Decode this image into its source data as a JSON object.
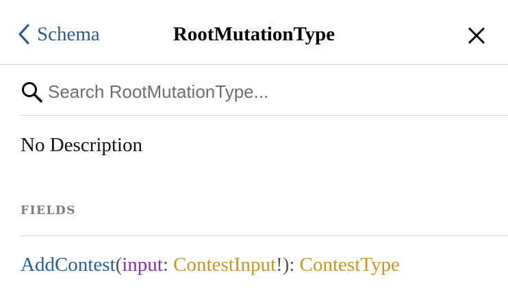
{
  "header": {
    "back_label": "Schema",
    "title": "RootMutationType"
  },
  "search": {
    "placeholder": "Search RootMutationType..."
  },
  "description": "No Description",
  "fields_section": {
    "title": "FIELDS",
    "fields": [
      {
        "name": "AddContest",
        "open_paren": "(",
        "arg_name": "input",
        "colon": ": ",
        "arg_type": "ContestInput",
        "non_null": "!",
        "close_paren": "):",
        "space": " ",
        "return_type": "ContestType"
      }
    ]
  },
  "colors": {
    "link": "#2f5a8f",
    "field_name": "#1f61a0",
    "arg_name": "#8b2bb9",
    "type_name": "#ca9622",
    "section_title": "#7a7a7a",
    "divider": "#d6d6d6"
  },
  "icons": {
    "back": "chevron-left-icon",
    "close": "close-icon",
    "search": "search-icon"
  }
}
